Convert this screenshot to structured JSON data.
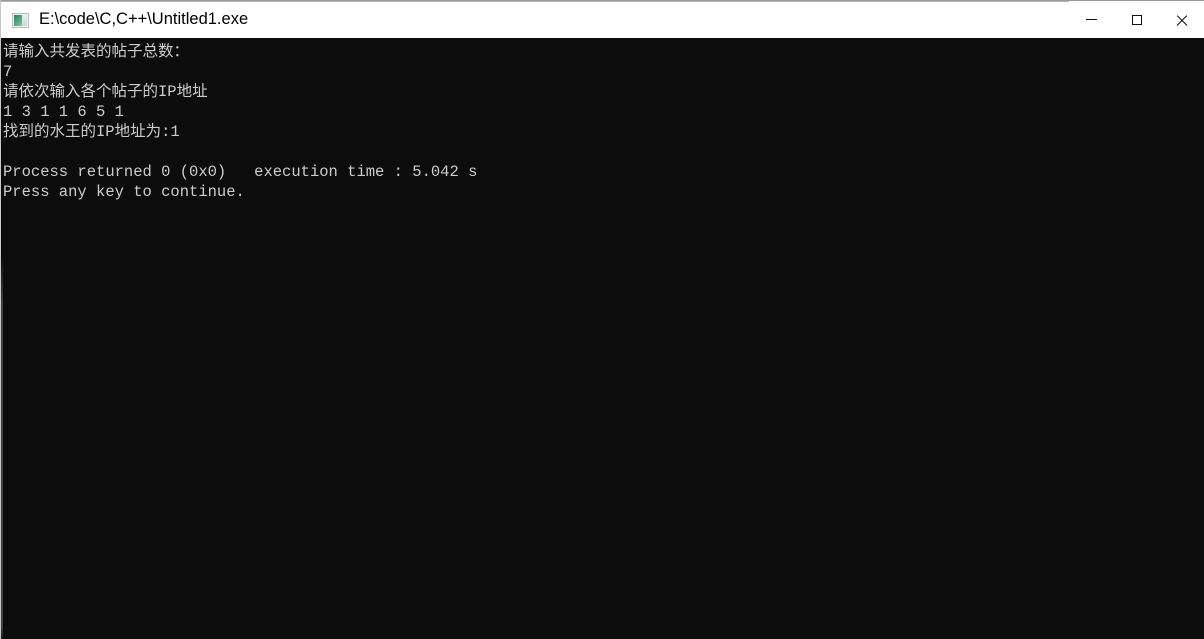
{
  "window": {
    "title": "E:\\code\\C,C++\\Untitled1.exe",
    "icon": "console-app-icon",
    "background_color": "#0c0c0c",
    "titlebar_color": "#ffffff",
    "text_color": "#cccccc"
  },
  "controls": {
    "minimize_label": "—",
    "minimize_name": "minimize-icon",
    "maximize_label": "□",
    "maximize_name": "maximize-icon",
    "close_label": "✕",
    "close_name": "close-icon"
  },
  "console": {
    "lines": [
      "请输入共发表的帖子总数：",
      "7",
      "请依次输入各个帖子的IP地址",
      "1 3 1 1 6 5 1",
      "找到的水王的IP地址为:1",
      "",
      "Process returned 0 (0x0)   execution time : 5.042 s",
      "Press any key to continue."
    ],
    "prompt_total_posts": "请输入共发表的帖子总数：",
    "input_total_posts": "7",
    "prompt_ip_list": "请依次输入各个帖子的IP地址",
    "input_ip_list": "1 3 1 1 6 5 1",
    "result_line": "找到的水王的IP地址为:1",
    "process_return": "Process returned 0 (0x0)   execution time : 5.042 s",
    "press_any_key": "Press any key to continue.",
    "exit_code": "0",
    "exit_code_hex": "0x0",
    "execution_time": "5.042 s"
  }
}
